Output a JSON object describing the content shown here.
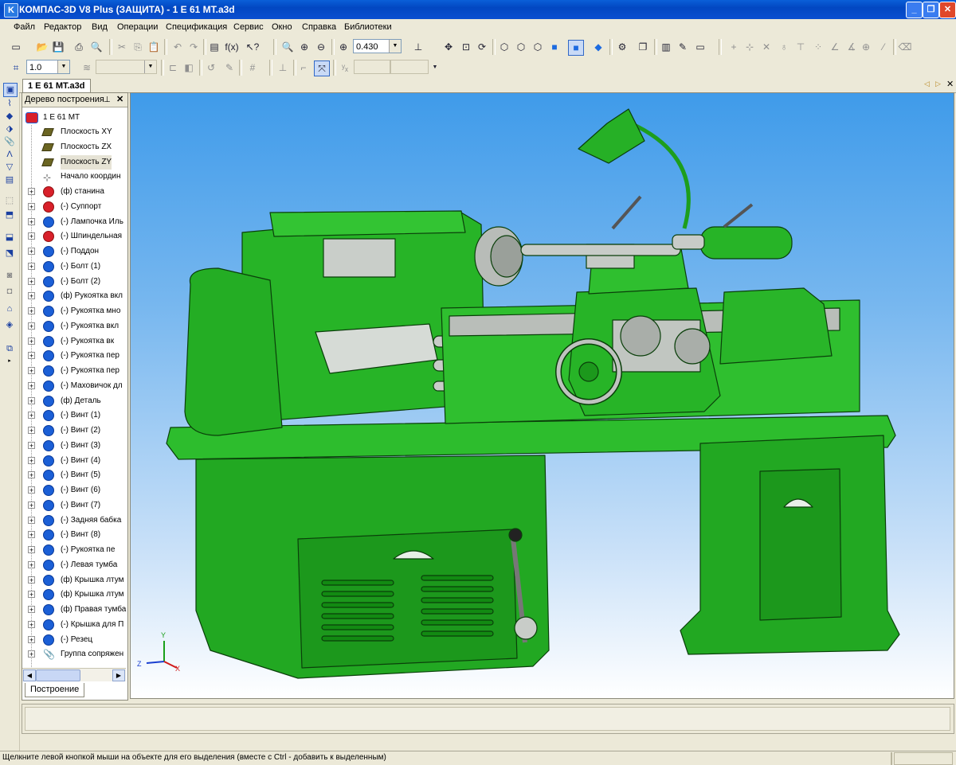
{
  "window": {
    "title": "КОМПАС-3D V8 Plus (ЗАЩИТА) - 1 Е 61 МТ.a3d"
  },
  "menu": [
    "Файл",
    "Редактор",
    "Вид",
    "Операции",
    "Спецификация",
    "Сервис",
    "Окно",
    "Справка",
    "Библиотеки"
  ],
  "toolbar": {
    "zoom_value": "0.430",
    "step_value": "1.0"
  },
  "document_tab": "1 Е 61 МТ.a3d",
  "tree": {
    "title": "Дерево построения",
    "root": "1 Е 61 МТ",
    "items": [
      {
        "label": "Плоскость XY",
        "kind": "plane",
        "expand": false
      },
      {
        "label": "Плоскость ZX",
        "kind": "plane",
        "expand": false
      },
      {
        "label": "Плоскость ZY",
        "kind": "plane",
        "expand": false
      },
      {
        "label": "Начало координ",
        "kind": "origin",
        "expand": false
      },
      {
        "label": "(ф) станина",
        "kind": "red",
        "expand": true
      },
      {
        "label": "(-) Суппорт",
        "kind": "red",
        "expand": true
      },
      {
        "label": "(-) Лампочка Иль",
        "kind": "blue",
        "expand": true
      },
      {
        "label": "(-) Шпиндельная",
        "kind": "red",
        "expand": true
      },
      {
        "label": "(-) Поддон",
        "kind": "blue",
        "expand": true
      },
      {
        "label": "(-) Болт (1)",
        "kind": "blue",
        "expand": true
      },
      {
        "label": "(-) Болт (2)",
        "kind": "blue",
        "expand": true
      },
      {
        "label": "(ф) Рукоятка вкл",
        "kind": "blue",
        "expand": true
      },
      {
        "label": "(-) Рукоятка мно",
        "kind": "blue",
        "expand": true
      },
      {
        "label": "(-) Рукоятка вкл",
        "kind": "blue",
        "expand": true
      },
      {
        "label": "(-) Рукоятка   вк",
        "kind": "blue",
        "expand": true
      },
      {
        "label": "(-) Рукоятка пер",
        "kind": "blue",
        "expand": true
      },
      {
        "label": "(-) Рукоятка   пер",
        "kind": "blue",
        "expand": true
      },
      {
        "label": "(-) Маховичок дл",
        "kind": "blue",
        "expand": true
      },
      {
        "label": "(ф) Деталь",
        "kind": "blue",
        "expand": true
      },
      {
        "label": "(-) Винт (1)",
        "kind": "blue",
        "expand": true
      },
      {
        "label": "(-) Винт (2)",
        "kind": "blue",
        "expand": true
      },
      {
        "label": "(-) Винт (3)",
        "kind": "blue",
        "expand": true
      },
      {
        "label": "(-) Винт (4)",
        "kind": "blue",
        "expand": true
      },
      {
        "label": "(-) Винт (5)",
        "kind": "blue",
        "expand": true
      },
      {
        "label": "(-) Винт (6)",
        "kind": "blue",
        "expand": true
      },
      {
        "label": "(-) Винт (7)",
        "kind": "blue",
        "expand": true
      },
      {
        "label": "(-) Задняя бабка",
        "kind": "blue",
        "expand": true
      },
      {
        "label": "(-) Винт (8)",
        "kind": "blue",
        "expand": true
      },
      {
        "label": "(-) Рукоятка    пе",
        "kind": "blue",
        "expand": true
      },
      {
        "label": "(-) Левая тумба",
        "kind": "blue",
        "expand": true
      },
      {
        "label": "(ф) Крышка лтум",
        "kind": "blue",
        "expand": true
      },
      {
        "label": "(ф) Крышка лтум",
        "kind": "blue",
        "expand": true
      },
      {
        "label": "(ф) Правая тумба",
        "kind": "blue",
        "expand": true
      },
      {
        "label": "(-) Крышка для П",
        "kind": "blue",
        "expand": true
      },
      {
        "label": "(-) Резец",
        "kind": "blue",
        "expand": true
      },
      {
        "label": "Группа сопряжен",
        "kind": "clip",
        "expand": true
      }
    ],
    "bottom_tab": "Построение"
  },
  "axes_labels": {
    "y": "Y",
    "z": "Z",
    "x": "X"
  },
  "status_text": "Щелкните левой кнопкой мыши на объекте для его выделения (вместе с Ctrl - добавить к выделенным)",
  "colors": {
    "machine_green": "#1fae1f",
    "title_blue": "#0a4fd0"
  }
}
